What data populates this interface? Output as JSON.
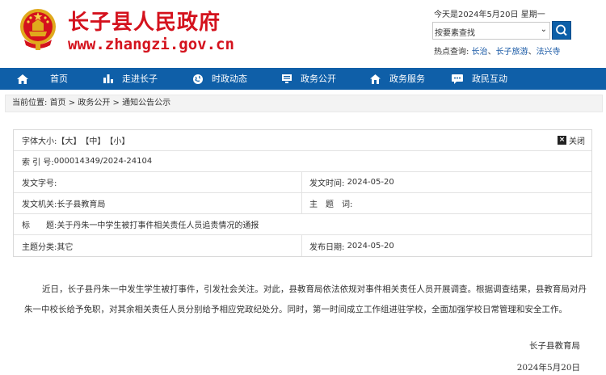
{
  "header": {
    "site_title": "长子县人民政府",
    "site_url": "www.zhangzi.gov.cn",
    "date_text": "今天是2024年5月20日 星期一",
    "search_select": "按要素查找",
    "hot_label": "热点查询:",
    "hot_links": [
      "长治",
      "长子旅游",
      "法兴寺"
    ]
  },
  "nav": {
    "items": [
      {
        "label": "首页",
        "icon": "home-icon"
      },
      {
        "label": "走进长子",
        "icon": "bar-chart-icon"
      },
      {
        "label": "时政动态",
        "icon": "globe-icon"
      },
      {
        "label": "政务公开",
        "icon": "monitor-icon"
      },
      {
        "label": "政务服务",
        "icon": "house-icon"
      },
      {
        "label": "政民互动",
        "icon": "chat-icon"
      }
    ]
  },
  "breadcrumb": {
    "prefix": "当前位置:",
    "items": [
      "首页",
      "政务公开",
      "通知公告公示"
    ],
    "sep": ">"
  },
  "info": {
    "font_size_label": "字体大小:",
    "font_sizes": [
      "【大】",
      "【中】",
      "【小】"
    ],
    "close_label": "关闭",
    "index_label": "索 引 号:",
    "index_value": "000014349/2024-24104",
    "doc_no_label": "发文字号:",
    "doc_time_label": "发文时间:",
    "doc_time_value": "2024-05-20",
    "issuer_label": "发文机关:",
    "issuer_value": "长子县教育局",
    "subject_label": "主　题　词:",
    "title_label": "标　　题:",
    "title_value": "关于丹朱一中学生被打事件相关责任人员追责情况的通报",
    "category_label": "主题分类:",
    "category_value": "其它",
    "publish_label": "发布日期:",
    "publish_value": "2024-05-20"
  },
  "article": {
    "body": "近日，长子县丹朱一中发生学生被打事件，引发社会关注。对此，县教育局依法依规对事件相关责任人员开展调查。根据调查结果，县教育局对丹朱一中校长给予免职，对其余相关责任人员分别给予相应党政纪处分。同时，第一时间成立工作组进驻学校，全面加强学校日常管理和安全工作。",
    "signature": "长子县教育局",
    "date": "2024年5月20日"
  },
  "colors": {
    "brand_red": "#d4121d",
    "nav_blue": "#0f5fa8"
  }
}
